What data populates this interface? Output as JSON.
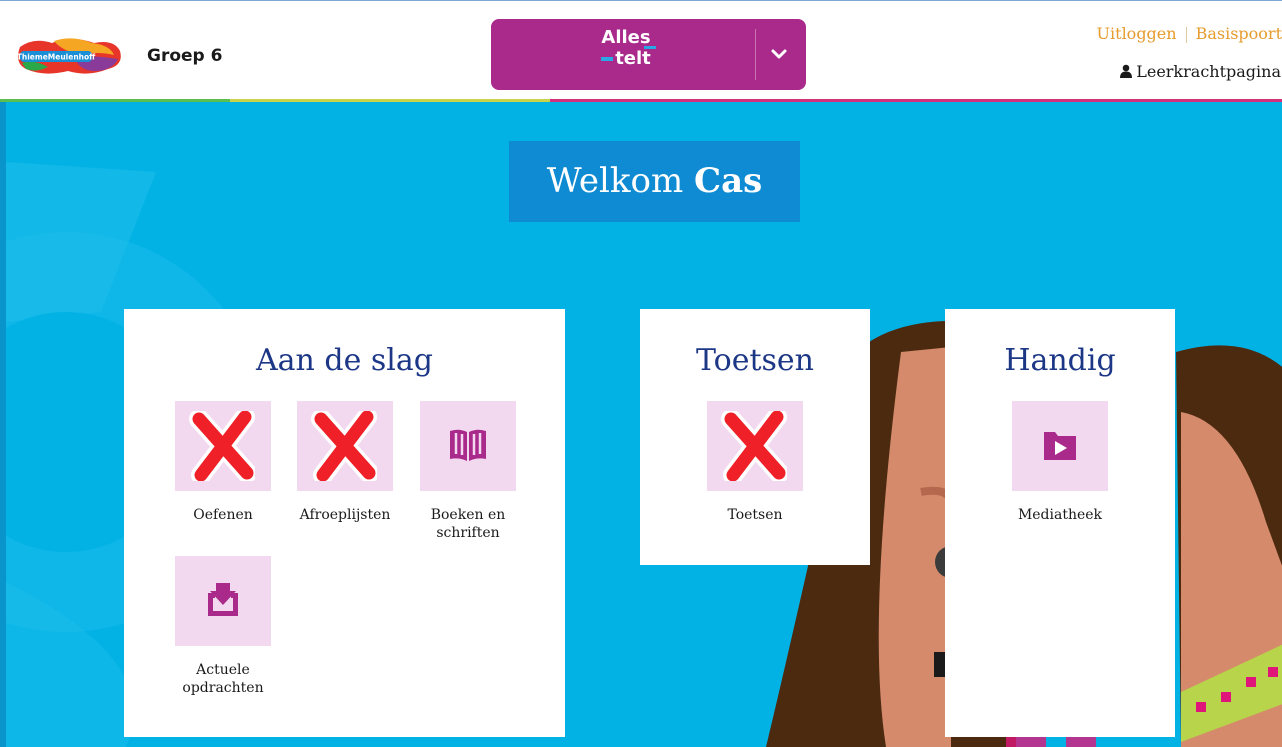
{
  "header": {
    "logo_text": "ThiemeMeulenhoff",
    "group": "Groep 6",
    "brand_line1": "Alles",
    "brand_line2": "telt",
    "logout": "Uitloggen",
    "basispoort": "Basispoort",
    "teacher_page": "Leerkrachtpagina"
  },
  "welcome": {
    "prefix": "Welkom",
    "name": "Cas"
  },
  "cards": {
    "aan_de_slag": {
      "title": "Aan de slag",
      "tiles": [
        {
          "label": "Oefenen",
          "icon": "x-mark-icon"
        },
        {
          "label": "Afroeplijsten",
          "icon": "x-mark-icon"
        },
        {
          "label": "Boeken en schriften",
          "icon": "book-icon"
        },
        {
          "label": "Actuele opdrachten",
          "icon": "inbox-download-icon"
        }
      ]
    },
    "toetsen": {
      "title": "Toetsen",
      "tiles": [
        {
          "label": "Toetsen",
          "icon": "x-mark-icon"
        }
      ]
    },
    "handig": {
      "title": "Handig",
      "tiles": [
        {
          "label": "Mediatheek",
          "icon": "media-folder-icon"
        }
      ]
    }
  },
  "colors": {
    "brand": "#a92a8a",
    "background": "#03b2e5",
    "welcome_bg": "#0e8bd2",
    "title": "#1d3787",
    "link": "#e69b2d",
    "tile_bg": "#f3d9ef"
  }
}
